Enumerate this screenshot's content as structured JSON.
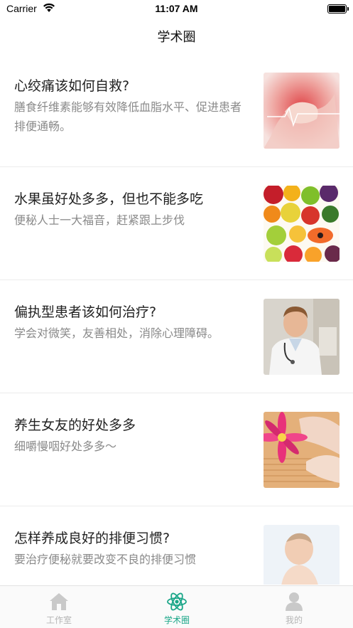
{
  "status_bar": {
    "carrier": "Carrier",
    "time": "11:07 AM"
  },
  "nav": {
    "title": "学术圈"
  },
  "articles": [
    {
      "title": "心绞痛该如何自救?",
      "summary": "膳食纤维素能够有效降低血脂水平、促进患者排便通畅。",
      "image": "chest-pain-photo"
    },
    {
      "title": "水果虽好处多多，但也不能多吃",
      "summary": "便秘人士一大福音，赶紧跟上步伐",
      "image": "fruit-photo"
    },
    {
      "title": "偏执型患者该如何治疗?",
      "summary": "学会对微笑，友善相处，消除心理障碍。",
      "image": "doctor-photo"
    },
    {
      "title": "养生女友的好处多多",
      "summary": "细嚼慢咽好处多多～",
      "image": "spa-flower-photo"
    },
    {
      "title": "怎样养成良好的排便习惯?",
      "summary": "要治疗便秘就要改变不良的排便习惯",
      "image": "baby-photo"
    }
  ],
  "tabs": [
    {
      "label": "工作室",
      "icon": "home-icon",
      "active": false
    },
    {
      "label": "学术圈",
      "icon": "atom-icon",
      "active": true
    },
    {
      "label": "我的",
      "icon": "person-icon",
      "active": false
    }
  ],
  "colors": {
    "accent": "#1aa688",
    "inactive": "#b5b5b5",
    "summary_text": "#8a8a8a"
  }
}
